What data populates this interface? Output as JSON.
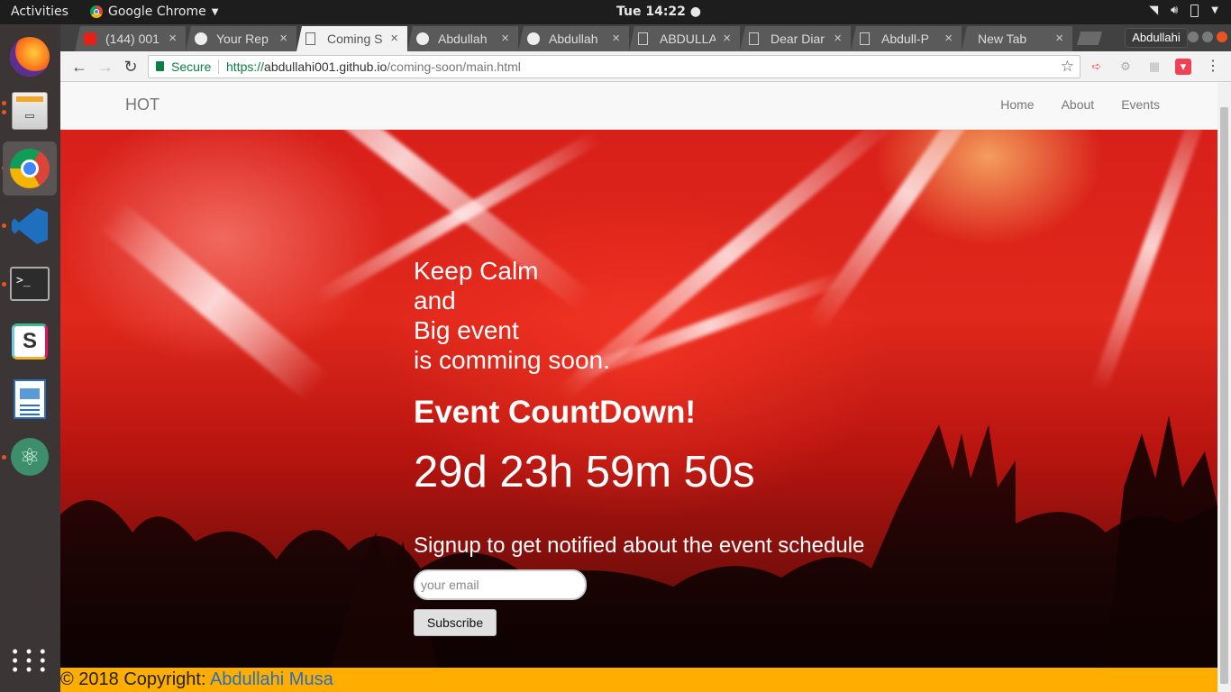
{
  "topbar": {
    "activities": "Activities",
    "app_name": "Google Chrome",
    "clock": "Tue 14:22"
  },
  "dock": {
    "items": [
      "firefox",
      "files",
      "chrome",
      "vscode",
      "terminal",
      "slack",
      "writer",
      "atom",
      "show-apps"
    ]
  },
  "chrome": {
    "tabs": [
      {
        "title": "(144) 001",
        "icon": "youtube-icon",
        "active": false
      },
      {
        "title": "Your Rep",
        "icon": "github-icon",
        "active": false
      },
      {
        "title": "Coming S",
        "icon": "page-icon",
        "active": true
      },
      {
        "title": "Abdullah",
        "icon": "github-icon",
        "active": false
      },
      {
        "title": "Abdullah",
        "icon": "github-icon",
        "active": false
      },
      {
        "title": "ABDULLA",
        "icon": "page-icon",
        "active": false
      },
      {
        "title": "Dear Diar",
        "icon": "page-icon",
        "active": false
      },
      {
        "title": "Abdull-P",
        "icon": "page-icon",
        "active": false
      },
      {
        "title": "New Tab",
        "icon": "",
        "active": false
      }
    ],
    "tab_close": "×",
    "profile": "Abdullahi",
    "omnibox": {
      "secure_label": "Secure",
      "url_scheme": "https://",
      "url_host": "abdullahi001.github.io",
      "url_path": "/coming-soon/main.html"
    }
  },
  "page": {
    "brand": "HOT",
    "nav": [
      "Home",
      "About",
      "Events"
    ],
    "tagline": [
      "Keep Calm",
      "and",
      "Big event",
      "is comming soon."
    ],
    "countdown_title": "Event CountDown!",
    "countdown": "29d 23h 59m 50s",
    "signup_text": "Signup to get notified about the event schedule",
    "email_placeholder": "your email",
    "subscribe_label": "Subscribe",
    "footer_prefix": "© 2018 Copyright: ",
    "footer_author": "Abdullahi Musa"
  },
  "colors": {
    "footer_bg": "#ffae00",
    "footer_link": "#2a6ebb",
    "hero_red": "#d8201a",
    "secure_green": "#0b8043"
  }
}
